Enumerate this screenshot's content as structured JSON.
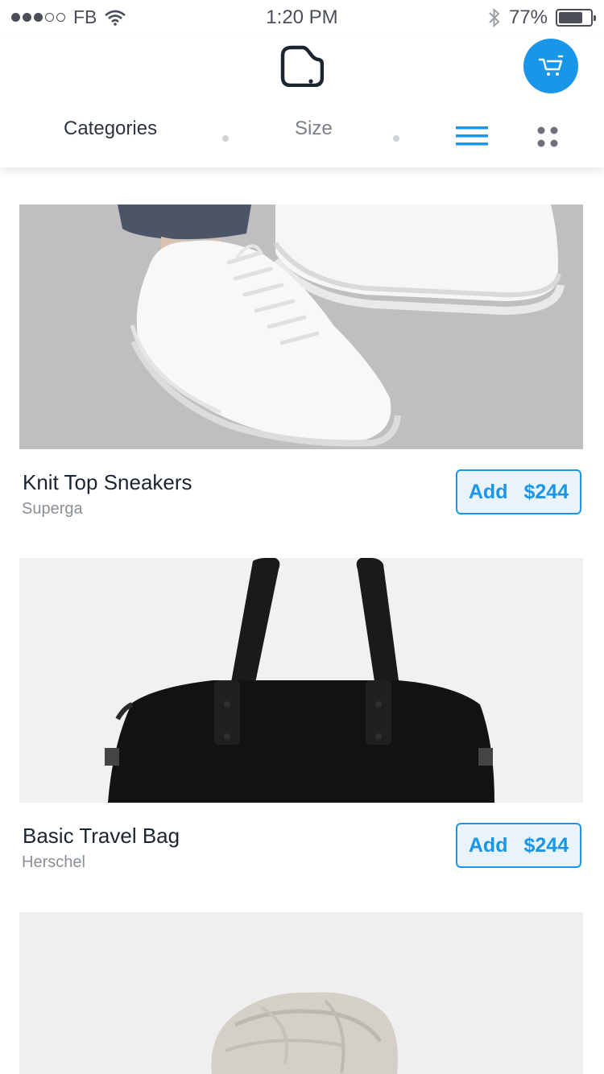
{
  "status_bar": {
    "carrier": "FB",
    "time": "1:20 PM",
    "battery_text": "77%",
    "battery_level": 0.77,
    "signal_bars_filled": 3,
    "signal_bars_total": 5
  },
  "header": {
    "logo_icon": "rounded-square-logo",
    "cart_icon": "shopping-cart-icon",
    "accent_color": "#1996e8"
  },
  "filters": {
    "categories_label": "Categories",
    "size_label": "Size",
    "active_view": "list"
  },
  "products": [
    {
      "name": "Knit Top Sneakers",
      "brand": "Superga",
      "add_label": "Add",
      "price": "$244"
    },
    {
      "name": "Basic Travel Bag",
      "brand": "Herschel",
      "add_label": "Add",
      "price": "$244"
    }
  ]
}
